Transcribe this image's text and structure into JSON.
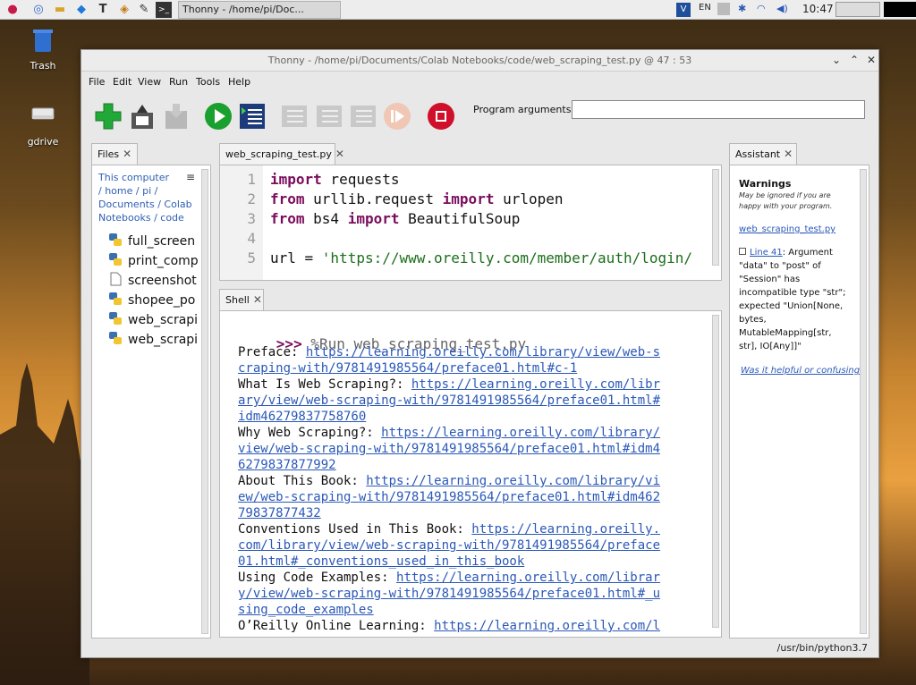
{
  "taskbar": {
    "task_title": "Thonny  -  /home/pi/Doc...",
    "lang": "EN",
    "clock": "10:47"
  },
  "desktop": {
    "trash_label": "Trash",
    "gdrive_label": "gdrive"
  },
  "window": {
    "title": "Thonny  -  /home/pi/Documents/Colab Notebooks/code/web_scraping_test.py  @  47 : 53"
  },
  "menu": [
    "File",
    "Edit",
    "View",
    "Run",
    "Tools",
    "Help"
  ],
  "toolbar": {
    "program_arguments_label": "Program arguments:",
    "program_arguments_value": ""
  },
  "files_panel": {
    "tab_label": "Files",
    "breadcrumb": "This computer\n/ home / pi /\nDocuments / Colab\nNotebooks / code",
    "breadcrumb_lines": [
      "This computer",
      "/ home / pi /",
      "Documents / Colab",
      "Notebooks / code"
    ],
    "files": [
      {
        "name": "full_screen",
        "icon": "python-icon"
      },
      {
        "name": "print_comp",
        "icon": "python-icon"
      },
      {
        "name": "screenshot",
        "icon": "file-icon"
      },
      {
        "name": "shopee_po",
        "icon": "python-icon"
      },
      {
        "name": "web_scrapi",
        "icon": "python-icon"
      },
      {
        "name": "web_scrapi",
        "icon": "python-icon"
      }
    ]
  },
  "editor": {
    "tab_label": "web_scraping_test.py",
    "line_numbers": [
      "1",
      "2",
      "3",
      "4",
      "5"
    ]
  },
  "shell": {
    "tab_label": "Shell",
    "prompt": ">>>",
    "command": " %Run web_scraping_test.py",
    "lines": [
      {
        "text": "Preface: ",
        "link": "https://learning.oreilly.com/library/view/web-s"
      },
      {
        "text": "",
        "link": "craping-with/9781491985564/preface01.html#c-1"
      },
      {
        "text": "What Is Web Scraping?: ",
        "link": "https://learning.oreilly.com/libr"
      },
      {
        "text": "",
        "link": "ary/view/web-scraping-with/9781491985564/preface01.html#"
      },
      {
        "text": "",
        "link": "idm46279837758760"
      },
      {
        "text": "Why Web Scraping?: ",
        "link": "https://learning.oreilly.com/library/"
      },
      {
        "text": "",
        "link": "view/web-scraping-with/9781491985564/preface01.html#idm4"
      },
      {
        "text": "",
        "link": "6279837877992"
      },
      {
        "text": "About This Book: ",
        "link": "https://learning.oreilly.com/library/vi"
      },
      {
        "text": "",
        "link": "ew/web-scraping-with/9781491985564/preface01.html#idm462"
      },
      {
        "text": "",
        "link": "79837877432"
      },
      {
        "text": "Conventions Used in This Book: ",
        "link": "https://learning.oreilly."
      },
      {
        "text": "",
        "link": "com/library/view/web-scraping-with/9781491985564/preface"
      },
      {
        "text": "",
        "link": "01.html#_conventions_used_in_this_book"
      },
      {
        "text": "Using Code Examples: ",
        "link": "https://learning.oreilly.com/librar"
      },
      {
        "text": "",
        "link": "y/view/web-scraping-with/9781491985564/preface01.html#_u"
      },
      {
        "text": "",
        "link": "sing_code_examples"
      },
      {
        "text": "O’Reilly Online Learning: ",
        "link": "https://learning.oreilly.com/l"
      }
    ]
  },
  "assistant": {
    "tab_label": "Assistant",
    "title": "Warnings",
    "subtitle": "May be ignored if you are happy with your program.",
    "file_link": "web_scraping_test.py",
    "warning_link": "Line 41",
    "warning_text": ": Argument \"data\" to \"post\" of \"Session\" has incompatible type \"str\"; expected \"Union[None, bytes, MutableMapping[str, str], IO[Any]]\"",
    "help_link": "Was it helpful or confusing?"
  },
  "status_bar": {
    "interpreter": "/usr/bin/python3.7"
  },
  "colors": {
    "keyword": "#7a0d5b",
    "string": "#1c6e1c",
    "link": "#2a58b8",
    "run_green": "#1aa02e",
    "stop_red": "#d0102a"
  }
}
